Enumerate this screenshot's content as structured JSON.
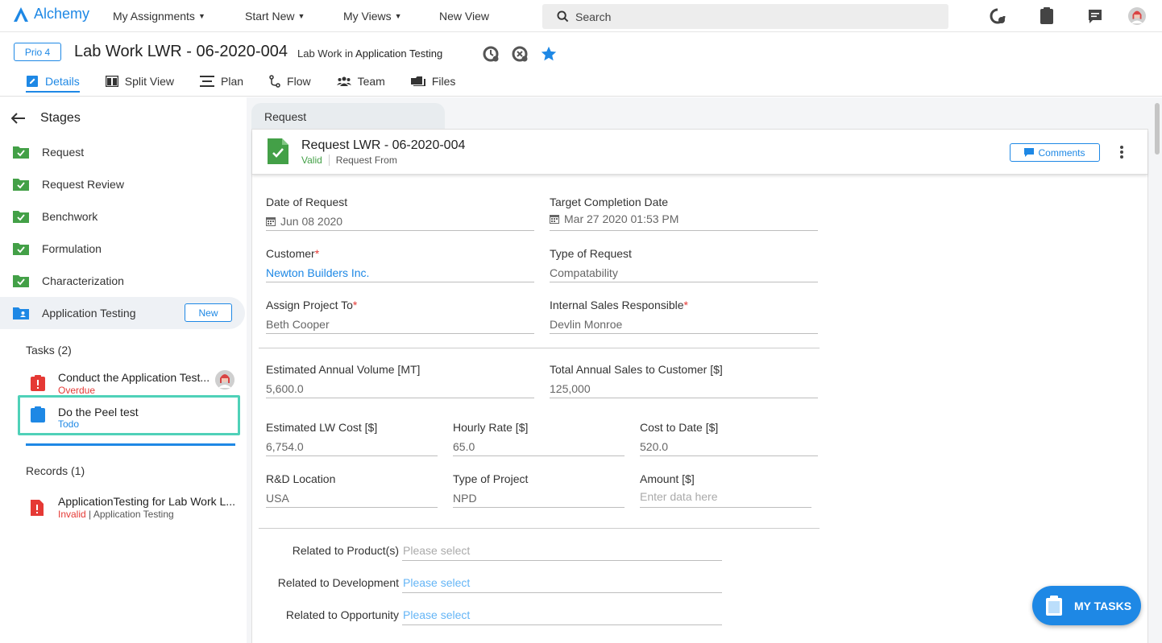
{
  "topnav": {
    "app_name": "Alchemy",
    "menu": [
      {
        "label": "My Assignments"
      },
      {
        "label": "Start New"
      },
      {
        "label": "My Views"
      },
      {
        "label": "New View"
      }
    ],
    "search_placeholder": "Search"
  },
  "header": {
    "priority": "Prio 4",
    "title": "Lab Work LWR - 06-2020-004",
    "subtitle_prefix": "Lab Work in",
    "subtitle_stage": "Application Testing",
    "tabs": [
      {
        "label": "Details",
        "icon": "edit-doc-icon",
        "active": true
      },
      {
        "label": "Split View",
        "icon": "split-view-icon"
      },
      {
        "label": "Plan",
        "icon": "plan-icon"
      },
      {
        "label": "Flow",
        "icon": "flow-icon"
      },
      {
        "label": "Team",
        "icon": "team-icon"
      },
      {
        "label": "Files",
        "icon": "files-icon"
      }
    ]
  },
  "sidebar": {
    "stages_title": "Stages",
    "stages": [
      {
        "label": "Request",
        "status": "done"
      },
      {
        "label": "Request Review",
        "status": "done"
      },
      {
        "label": "Benchwork",
        "status": "done"
      },
      {
        "label": "Formulation",
        "status": "done"
      },
      {
        "label": "Characterization",
        "status": "done"
      },
      {
        "label": "Application Testing",
        "status": "current",
        "badge": "New"
      }
    ],
    "tasks_title": "Tasks (2)",
    "tasks": [
      {
        "name": "Conduct the Application Test...",
        "status": "Overdue"
      },
      {
        "name": "Do the Peel test",
        "status": "Todo"
      }
    ],
    "records_title": "Records (1)",
    "records": [
      {
        "name": "ApplicationTesting for Lab Work L...",
        "status": "Invalid",
        "sub": "| Application Testing"
      }
    ]
  },
  "main": {
    "section_tab": "Request",
    "card": {
      "title": "Request LWR - 06-2020-004",
      "valid": "Valid",
      "type": "Request From",
      "comments_label": "Comments"
    },
    "fields": {
      "date_of_request": {
        "label": "Date of Request",
        "value": "Jun 08 2020"
      },
      "target_completion": {
        "label": "Target Completion Date",
        "value": "Mar 27 2020 01:53 PM"
      },
      "customer": {
        "label": "Customer",
        "value": "Newton Builders Inc."
      },
      "type_of_request": {
        "label": "Type of Request",
        "value": "Compatability"
      },
      "assign_project": {
        "label": "Assign Project To",
        "value": "Beth Cooper"
      },
      "internal_sales": {
        "label": "Internal Sales Responsible",
        "value": "Devlin Monroe"
      },
      "annual_volume": {
        "label": "Estimated Annual Volume [MT]",
        "value": "5,600.0"
      },
      "annual_sales": {
        "label": "Total Annual Sales to Customer [$]",
        "value": "125,000"
      },
      "lw_cost": {
        "label": "Estimated LW Cost [$]",
        "value": "6,754.0"
      },
      "hourly_rate": {
        "label": "Hourly Rate [$]",
        "value": "65.0"
      },
      "cost_to_date": {
        "label": "Cost to Date [$]",
        "value": "520.0"
      },
      "rd_location": {
        "label": "R&D Location",
        "value": "USA"
      },
      "type_of_project": {
        "label": "Type of Project",
        "value": "NPD"
      },
      "amount": {
        "label": "Amount [$]",
        "placeholder": "Enter data here"
      }
    },
    "related": [
      {
        "label": "Related to Product(s)",
        "placeholder": "Please select"
      },
      {
        "label": "Related to Development",
        "placeholder": "Please select"
      },
      {
        "label": "Related to Opportunity",
        "placeholder": "Please select"
      }
    ]
  },
  "fab": {
    "label": "MY TASKS"
  },
  "colors": {
    "accent": "#1e88e5",
    "success": "#43a047",
    "danger": "#e53935",
    "selection": "#4fd1b8"
  }
}
